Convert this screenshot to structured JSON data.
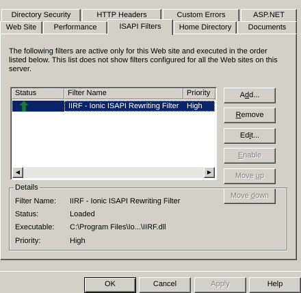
{
  "tabs_back": [
    {
      "label": "Directory Security"
    },
    {
      "label": "HTTP Headers"
    },
    {
      "label": "Custom Errors"
    },
    {
      "label": "ASP.NET"
    }
  ],
  "tabs_front": [
    {
      "label": "Web Site"
    },
    {
      "label": "Performance"
    },
    {
      "label": "ISAPI Filters"
    },
    {
      "label": "Home Directory"
    },
    {
      "label": "Documents"
    }
  ],
  "active_tab": "ISAPI Filters",
  "description": "The following filters are active only for this Web site and executed in the order listed below. This list does not show filters configured for all the Web sites on this server.",
  "filters_list": {
    "columns": [
      "Status",
      "Filter Name",
      "Priority"
    ],
    "rows": [
      {
        "status_icon": "green-up-arrow-icon",
        "name": "IIRF - Ionic ISAPI Rewriting Filter",
        "priority": "High",
        "selected": true
      }
    ]
  },
  "side_buttons": {
    "add": {
      "pre": "A",
      "key": "d",
      "post": "d...",
      "enabled": true
    },
    "remove": {
      "pre": "",
      "key": "R",
      "post": "emove",
      "enabled": true
    },
    "edit": {
      "pre": "Ed",
      "key": "i",
      "post": "t...",
      "enabled": true
    },
    "enable": {
      "pre": "",
      "key": "E",
      "post": "nable",
      "enabled": false
    },
    "move_up": {
      "pre": "Move ",
      "key": "u",
      "post": "p",
      "enabled": false
    },
    "move_down": {
      "pre": "Move ",
      "key": "d",
      "post": "own",
      "enabled": false
    }
  },
  "details": {
    "legend": "Details",
    "filter_name_label": "Filter Name:",
    "filter_name": "IIRF - Ionic ISAPI Rewriting Filter",
    "status_label": "Status:",
    "status": "Loaded",
    "executable_label": "Executable:",
    "executable": "C:\\Program Files\\Io...\\IIRF.dll",
    "priority_label": "Priority:",
    "priority": "High"
  },
  "dialog_buttons": {
    "ok": "OK",
    "cancel": "Cancel",
    "apply": "Apply",
    "help": "Help"
  },
  "colors": {
    "face": "#d4d0c8",
    "selection": "#0a246a",
    "status_icon": "#1a7a3a"
  }
}
